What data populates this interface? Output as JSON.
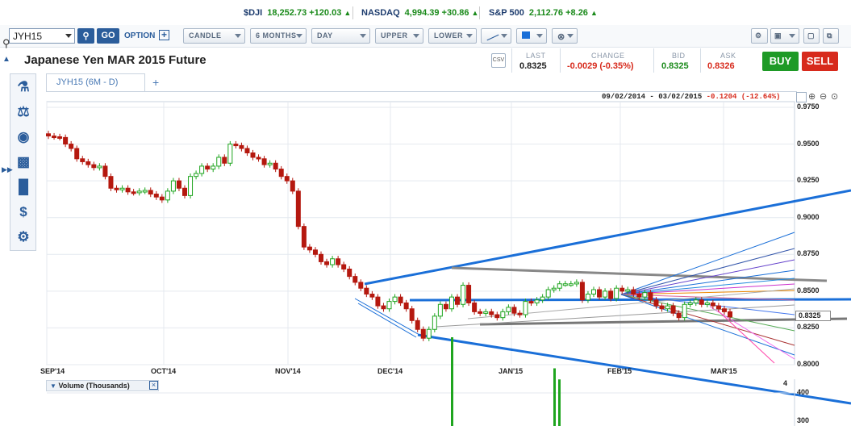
{
  "tickers": [
    {
      "name": "$DJI",
      "value": "18,252.73 +120.03"
    },
    {
      "name": "NASDAQ",
      "value": "4,994.39 +30.86"
    },
    {
      "name": "S&P 500",
      "value": "2,112.76 +8.26"
    }
  ],
  "toolbar": {
    "symbol": "JYH15",
    "go": "GO",
    "option": "OPTION",
    "chart_type": "CANDLE",
    "period": "6 MONTHS",
    "interval": "DAY",
    "upper": "UPPER",
    "lower": "LOWER"
  },
  "title": "Japanese Yen MAR 2015 Future",
  "quote": {
    "last_label": "LAST",
    "last": "0.8325",
    "change_label": "CHANGE",
    "change": "-0.0029 (-0.35%)",
    "bid_label": "BID",
    "bid": "0.8325",
    "ask_label": "ASK",
    "ask": "0.8326",
    "buy": "BUY",
    "sell": "SELL"
  },
  "tab": {
    "label": "JYH15 (6M - D)",
    "add": "+"
  },
  "range": {
    "dates": "09/02/2014 - 03/02/2015",
    "change": "-0.1204 (-12.64%)"
  },
  "current_price_label": "0.8325",
  "volume_panel": {
    "title": "Volume (Thousands)",
    "ticks": [
      "400",
      "300"
    ],
    "side_value": "4"
  },
  "colors": {
    "up": "#1fa51f",
    "down": "#b5180f",
    "trend": "#1a6fd8",
    "accent": "#2b5d9b"
  },
  "chart_data": {
    "type": "candlestick",
    "xlabels": [
      "SEP'14",
      "OCT'14",
      "NOV'14",
      "DEC'14",
      "JAN'15",
      "FEB'15",
      "MAR'15"
    ],
    "yticks": [
      "0.9750",
      "0.9500",
      "0.9250",
      "0.9000",
      "0.8750",
      "0.8500",
      "0.8250",
      "0.8000"
    ],
    "ylim": [
      0.8,
      0.975
    ],
    "closes": [
      0.9555,
      0.955,
      0.9545,
      0.95,
      0.947,
      0.94,
      0.938,
      0.936,
      0.934,
      0.935,
      0.928,
      0.92,
      0.919,
      0.92,
      0.9175,
      0.917,
      0.918,
      0.9185,
      0.916,
      0.914,
      0.912,
      0.918,
      0.925,
      0.92,
      0.915,
      0.928,
      0.93,
      0.935,
      0.933,
      0.935,
      0.941,
      0.937,
      0.95,
      0.949,
      0.947,
      0.944,
      0.941,
      0.94,
      0.936,
      0.937,
      0.933,
      0.928,
      0.925,
      0.918,
      0.894,
      0.88,
      0.878,
      0.875,
      0.87,
      0.868,
      0.872,
      0.868,
      0.865,
      0.86,
      0.856,
      0.852,
      0.848,
      0.846,
      0.84,
      0.838,
      0.843,
      0.846,
      0.842,
      0.838,
      0.83,
      0.824,
      0.818,
      0.824,
      0.833,
      0.841,
      0.838,
      0.846,
      0.841,
      0.854,
      0.842,
      0.836,
      0.835,
      0.836,
      0.834,
      0.832,
      0.836,
      0.839,
      0.835,
      0.834,
      0.843,
      0.842,
      0.844,
      0.846,
      0.851,
      0.852,
      0.855,
      0.855,
      0.855,
      0.856,
      0.844,
      0.848,
      0.851,
      0.846,
      0.85,
      0.845,
      0.852,
      0.85,
      0.851,
      0.848,
      0.846,
      0.849,
      0.844,
      0.84,
      0.838,
      0.84,
      0.835,
      0.832,
      0.841,
      0.842,
      0.844,
      0.841,
      0.842,
      0.84,
      0.838,
      0.836,
      0.8325
    ],
    "volume_bars": [
      {
        "x": "DEC'14",
        "value": 400
      },
      {
        "x": "JAN'15",
        "value": 330
      },
      {
        "x": "JAN'15",
        "value": 305
      }
    ],
    "trendlines": "blue channel lines, grey horizontal ranges, thin fan lines"
  }
}
